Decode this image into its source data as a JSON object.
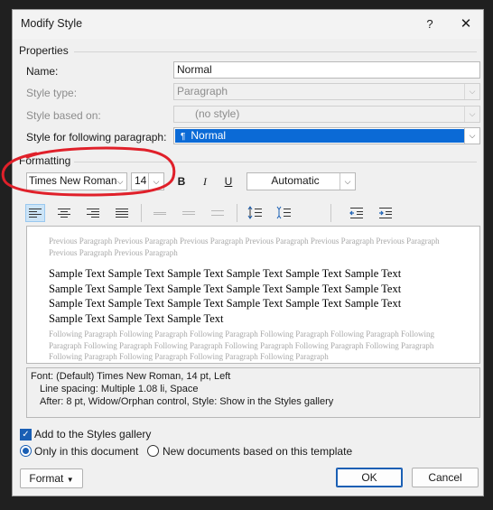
{
  "window": {
    "title": "Modify Style",
    "help": "?",
    "close": "✕"
  },
  "properties": {
    "heading": "Properties",
    "name_label": "Name:",
    "name_value": "Normal",
    "style_type_label": "Style type:",
    "style_type_value": "Paragraph",
    "based_on_label": "Style based on:",
    "based_on_value": "(no style)",
    "following_label": "Style for following paragraph:",
    "following_value": "Normal"
  },
  "formatting": {
    "heading": "Formatting",
    "font": "Times New Roman",
    "size": "14",
    "bold": "B",
    "italic": "I",
    "underline": "U",
    "color": "Automatic"
  },
  "preview": {
    "previous": "Previous Paragraph Previous Paragraph Previous Paragraph Previous Paragraph Previous Paragraph Previous Paragraph Previous Paragraph Previous Paragraph",
    "sample_lines": [
      "Sample Text Sample Text Sample Text Sample Text Sample Text Sample Text",
      "Sample Text Sample Text Sample Text Sample Text Sample Text Sample Text",
      "Sample Text Sample Text Sample Text Sample Text Sample Text Sample Text",
      "Sample Text Sample Text Sample Text"
    ],
    "following": "Following Paragraph Following Paragraph Following Paragraph Following Paragraph Following Paragraph Following Paragraph Following Paragraph Following Paragraph Following Paragraph Following Paragraph Following Paragraph Following Paragraph Following Paragraph Following Paragraph Following Paragraph"
  },
  "description": {
    "line1": "Font: (Default) Times New Roman, 14 pt, Left",
    "line2": "Line spacing:  Multiple 1.08 li, Space",
    "line3": "After:  8 pt, Widow/Orphan control, Style: Show in the Styles gallery"
  },
  "options": {
    "add_gallery": "Add to the Styles gallery",
    "add_gallery_checked": true,
    "only_doc": "Only in this document",
    "new_docs": "New documents based on this template",
    "selected_scope": "only_doc"
  },
  "buttons": {
    "format": "Format",
    "ok": "OK",
    "cancel": "Cancel"
  },
  "colors": {
    "accent": "#1a5fb4",
    "selection": "#0b6ad6",
    "annotation": "#e0202a"
  }
}
